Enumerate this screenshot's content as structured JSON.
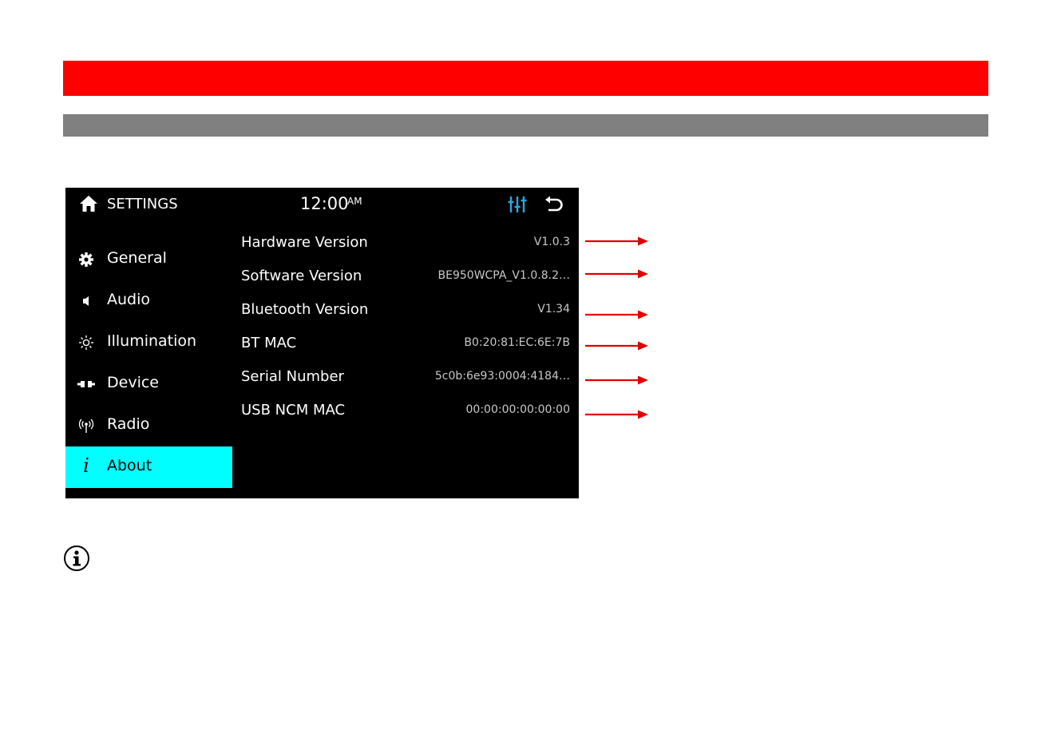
{
  "header": {
    "title": "SETTINGS",
    "time": "12:00",
    "ampm": "AM"
  },
  "sidebar": {
    "items": [
      {
        "label": "General",
        "icon": "gear-icon"
      },
      {
        "label": "Audio",
        "icon": "speaker-icon"
      },
      {
        "label": "Illumination",
        "icon": "sun-icon"
      },
      {
        "label": "Device",
        "icon": "device-icon"
      },
      {
        "label": "Radio",
        "icon": "radio-icon"
      },
      {
        "label": "About",
        "icon": "info-icon",
        "active": true
      }
    ]
  },
  "about": {
    "rows": [
      {
        "label": "Hardware Version",
        "value": "V1.0.3"
      },
      {
        "label": "Software Version",
        "value": "BE950WCPA_V1.0.8.2…"
      },
      {
        "label": "Bluetooth Version",
        "value": "V1.34"
      },
      {
        "label": "BT MAC",
        "value": "B0:20:81:EC:6E:7B"
      },
      {
        "label": "Serial Number",
        "value": "5c0b:6e93:0004:4184…"
      },
      {
        "label": "USB NCM MAC",
        "value": "00:00:00:00:00:00"
      }
    ]
  },
  "colors": {
    "banner": "#ff0000",
    "section_bar": "#808080",
    "active_tab": "#00ffff",
    "accent_icon": "#2aa7e0",
    "arrow": "#e00000"
  }
}
